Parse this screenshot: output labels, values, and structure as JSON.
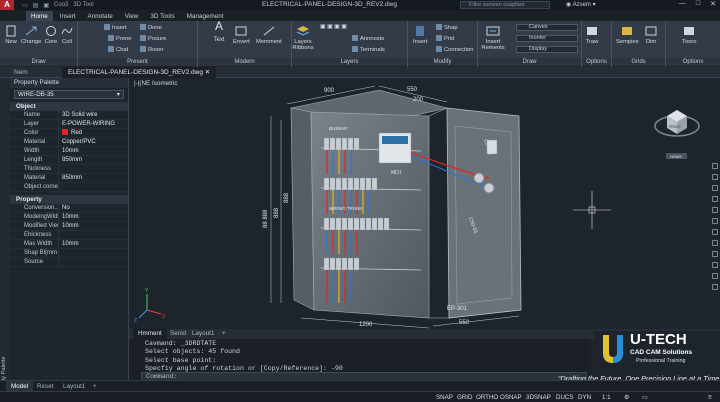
{
  "app": {
    "logo": "A",
    "title": "ELECTRICAL-PANEL-DESIGN-3D_REV2.dwg",
    "search_placeholder": "Filtre sonwen oxapfare",
    "user": "Azsem",
    "quick_access": [
      "Coo3",
      "3D Tool"
    ],
    "window_buttons": [
      "—",
      "□",
      "✕"
    ]
  },
  "ribbon_tabs": [
    "Home",
    "Insert",
    "Annotate",
    "View",
    "3D Tools",
    "Management"
  ],
  "ribbon": {
    "groups": [
      "Draw",
      "Present",
      "Modern",
      "Layers",
      "Modify",
      "Draw",
      "Options",
      "Grids",
      "Options"
    ],
    "draw_tools": [
      "New",
      "Change",
      "Core",
      "Coil"
    ],
    "present_tools": [
      "Insert",
      "Prene",
      "Chat",
      "Done",
      "Posure",
      "Roser"
    ],
    "modern_tools": [
      "Text",
      "Envert",
      "Memment"
    ],
    "layers_tools": [
      "Layers Ribbons",
      "Annnosts",
      "Terminals"
    ],
    "modify_tools": [
      "Insert",
      "Shap",
      "Prid",
      "Connection"
    ],
    "draw2_tools": [
      "Insert Rements",
      "Canves",
      "Inonter",
      "Display"
    ],
    "options_tools": [
      "Traw",
      "Sempies",
      "Dim",
      "Tooro"
    ]
  },
  "doc_tabs": [
    "Nem",
    "ELECTRICAL-PANEL-DESIGN-3D_REV2.dwg"
  ],
  "viewport_label": "|-|(NE Isometric",
  "view_cube": "FRONT",
  "view_home": "HOME",
  "palette": {
    "title": "Property Palette",
    "side_label": "Property Palette",
    "selected": "WIRE-DB-35",
    "sections": [
      {
        "title": "Object",
        "rows": [
          {
            "k": "Name",
            "v": "3D Solid wire"
          },
          {
            "k": "Layer",
            "v": "E-POWER-WIRING"
          },
          {
            "k": "Color",
            "v": "Red",
            "swatch": "#e02424"
          },
          {
            "k": "Material",
            "v": "Copper/PVC"
          },
          {
            "k": "Width",
            "v": "10mm"
          },
          {
            "k": "Length",
            "v": "850mm"
          },
          {
            "k": "Thickness",
            "v": ""
          },
          {
            "k": "Material",
            "v": "850mm"
          },
          {
            "k": "Object corner",
            "v": ""
          }
        ]
      },
      {
        "title": "Property",
        "rows": [
          {
            "k": "Conversion...",
            "v": "No"
          },
          {
            "k": "ModeingWidth",
            "v": "10mm"
          },
          {
            "k": "Modified View",
            "v": "10mm"
          },
          {
            "k": "Ehickness",
            "v": ""
          },
          {
            "k": "Mas Width",
            "v": "10mm"
          },
          {
            "k": "Shap Bl(mm",
            "v": ""
          },
          {
            "k": "Source",
            "v": ""
          }
        ]
      }
    ]
  },
  "drawing": {
    "dims": [
      "900",
      "550",
      "200",
      "88 888",
      "888",
      "888",
      "EP-301",
      "550",
      "C50-03",
      "1200",
      "C5-201",
      "MD1"
    ],
    "labels": [
      "BUSBAR",
      "WIRING TRUNK"
    ]
  },
  "ucs": {
    "x": "X",
    "y": "Y",
    "z": "Z"
  },
  "command_tabs": [
    "Hmment",
    "Senid",
    "Layout1",
    "+"
  ],
  "command_lines": [
    "Cavmand: _3DRDTATE",
    "Select objects: 45 found",
    "Select base point:",
    "Specfiy angle of rotation or [Copy/Reference]: -90"
  ],
  "command_prompt": "Command:",
  "brand": {
    "logo": "U",
    "name": "U-TECH",
    "sub": "CAD CAM Solutions",
    "tag": "Professional Training",
    "slogan": "Drafting the Future, One Precision Line at a Time."
  },
  "bottom_tabs": [
    "Model",
    "Reset",
    "Layout1",
    "+"
  ],
  "status": [
    "SNAP",
    "GRID",
    "ORTHO",
    "OSNAP",
    "3DSNAP",
    "DUCS",
    "DYN",
    "1:1",
    "⚙",
    "▭",
    "≡"
  ],
  "colors": {
    "accent": "#4aa3df",
    "wire_red": "#e02424",
    "panel_grey": "#6d747c"
  }
}
